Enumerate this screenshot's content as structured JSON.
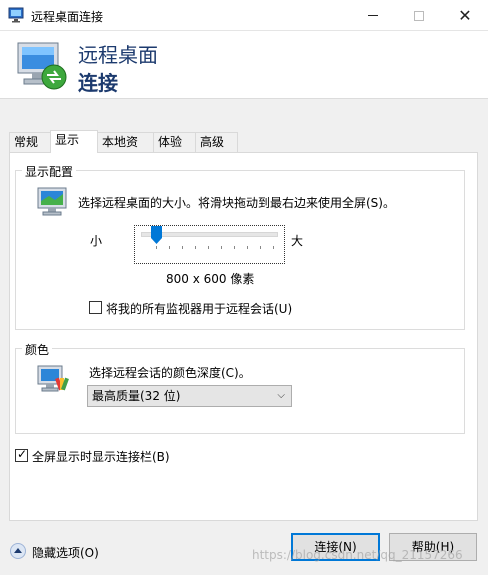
{
  "window": {
    "title": "远程桌面连接",
    "icon": "remote-desktop-icon",
    "minimize": "",
    "maximize": "",
    "close": "✕"
  },
  "banner": {
    "line1": "远程桌面",
    "line2": "连接",
    "icon": "remote-desktop-monitor-icon"
  },
  "tabs": [
    {
      "label": "常规",
      "active": false
    },
    {
      "label": "显示",
      "active": true
    },
    {
      "label": "本地资源",
      "active": false
    },
    {
      "label": "体验",
      "active": false
    },
    {
      "label": "高级",
      "active": false
    }
  ],
  "display_config": {
    "group_title": "显示配置",
    "description": "选择远程桌面的大小。将滑块拖动到最右边来使用全屏(S)。",
    "slider_min_label": "小",
    "slider_max_label": "大",
    "slider_position": 0.1,
    "resolution_text": "800 x 600 像素",
    "multi_monitor_label": "将我的所有监视器用于远程会话(U)",
    "multi_monitor_checked": false
  },
  "colors": {
    "group_title": "颜色",
    "description": "选择远程会话的颜色深度(C)。",
    "selected_depth": "最高质量(32 位)",
    "dropdown_arrow": "⌵"
  },
  "fullscreen_bar": {
    "label": "全屏显示时显示连接栏(B)",
    "checked": true,
    "check_glyph": "✓"
  },
  "footer": {
    "hide_options_label": "隐藏选项(O)",
    "connect_label": "连接(N)",
    "help_label": "帮助(H)"
  },
  "watermark": "https://blog.csdn.net/qq_21157266",
  "colors_theme": {
    "accent": "#0078d7",
    "banner_text": "#1c3a6e"
  }
}
